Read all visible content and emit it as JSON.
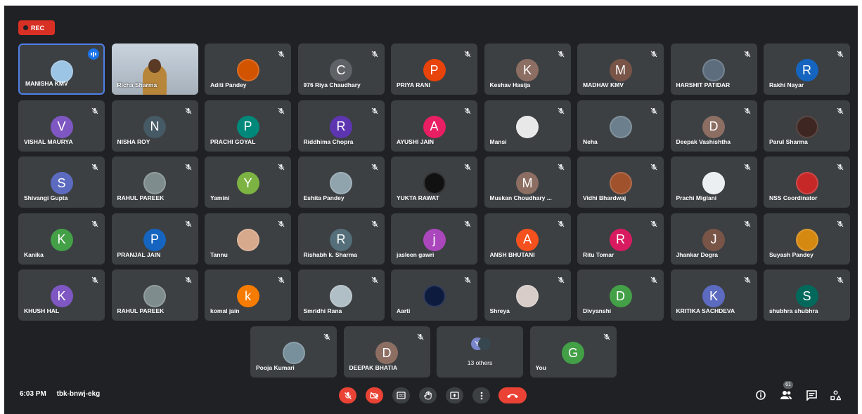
{
  "rec_label": "REC",
  "meeting": {
    "time": "6:03 PM",
    "code": "tbk-bnwj-ekg"
  },
  "participant_count_badge": "61",
  "tiles": [
    {
      "name": "MANISHA KMV",
      "type": "photo",
      "color": "#9cc4e4",
      "speaking": true
    },
    {
      "name": "Richa Sharma",
      "type": "video"
    },
    {
      "name": "Aditi Pandey",
      "type": "photo",
      "color": "#d35400"
    },
    {
      "name": "976 Riya Chaudhary",
      "initial": "C",
      "color": "#5f6368"
    },
    {
      "name": "PRIYA RANI",
      "initial": "P",
      "color": "#e8430a"
    },
    {
      "name": "Keshav Hasija",
      "initial": "K",
      "color": "#8d6e63"
    },
    {
      "name": "MADHAV KMV",
      "initial": "M",
      "color": "#795548"
    },
    {
      "name": "HARSHIT PATIDAR",
      "type": "photo",
      "color": "#5d6d7e"
    },
    {
      "name": "Rakhi Nayar",
      "initial": "R",
      "color": "#1565c0"
    },
    {
      "name": "VISHAL MAURYA",
      "initial": "V",
      "color": "#7e57c2"
    },
    {
      "name": "NISHA ROY",
      "initial": "N",
      "color": "#455a64"
    },
    {
      "name": "PRACHI GOYAL",
      "initial": "P",
      "color": "#00897b"
    },
    {
      "name": "Riddhima Chopra",
      "initial": "R",
      "color": "#5e35b1"
    },
    {
      "name": "AYUSHI JAIN",
      "initial": "A",
      "color": "#e91e63"
    },
    {
      "name": "Mansi",
      "type": "photo",
      "color": "#e8e8e8"
    },
    {
      "name": "Neha",
      "type": "photo",
      "color": "#6b7f8c"
    },
    {
      "name": "Deepak Vashishtha",
      "initial": "D",
      "color": "#8d6e63"
    },
    {
      "name": "Parul Sharma",
      "type": "photo",
      "color": "#3e2723"
    },
    {
      "name": "Shivangi Gupta",
      "initial": "S",
      "color": "#5c6bc0"
    },
    {
      "name": "RAHUL PAREEK",
      "type": "photo",
      "color": "#7f8c8d"
    },
    {
      "name": "Yamini",
      "initial": "Y",
      "color": "#7cb342"
    },
    {
      "name": "Eshita Pandey",
      "type": "photo",
      "color": "#90a4ae"
    },
    {
      "name": "YUKTA RAWAT",
      "type": "photo",
      "color": "#111111"
    },
    {
      "name": "Muskan Choudhary ...",
      "initial": "M",
      "color": "#8d6e63"
    },
    {
      "name": "Vidhi Bhardwaj",
      "type": "photo",
      "color": "#a0522d"
    },
    {
      "name": "Prachi Miglani",
      "type": "photo",
      "color": "#eceff1"
    },
    {
      "name": "NSS Coordinator",
      "type": "photo",
      "color": "#c62828"
    },
    {
      "name": "Kanika",
      "initial": "K",
      "color": "#43a047"
    },
    {
      "name": "PRANJAL JAIN",
      "initial": "P",
      "color": "#1565c0"
    },
    {
      "name": "Tannu",
      "type": "photo",
      "color": "#d7a98c"
    },
    {
      "name": "Rishabh k. Sharma",
      "initial": "R",
      "color": "#546e7a"
    },
    {
      "name": "jasleen gawri",
      "initial": "j",
      "color": "#ab47bc"
    },
    {
      "name": "ANSH BHUTANI",
      "initial": "A",
      "color": "#f4511e"
    },
    {
      "name": "Ritu Tomar",
      "initial": "R",
      "color": "#d81b60"
    },
    {
      "name": "Jhankar Dogra",
      "initial": "J",
      "color": "#795548"
    },
    {
      "name": "Suyash Pandey",
      "type": "photo",
      "color": "#d68910"
    },
    {
      "name": "KHUSH HAL",
      "initial": "K",
      "color": "#7e57c2"
    },
    {
      "name": "RAHUL PAREEK",
      "type": "photo",
      "color": "#7f8c8d"
    },
    {
      "name": "komal jain",
      "initial": "k",
      "color": "#f57c00"
    },
    {
      "name": "Smridhi Rana",
      "type": "photo",
      "color": "#b0bec5"
    },
    {
      "name": "Aarti",
      "type": "photo",
      "color": "#0d1b3e"
    },
    {
      "name": "Shreya",
      "type": "photo",
      "color": "#d7ccc8"
    },
    {
      "name": "Divyanshi",
      "initial": "D",
      "color": "#43a047"
    },
    {
      "name": "KRITIKA SACHDEVA",
      "initial": "K",
      "color": "#5c6bc0"
    },
    {
      "name": "shubhra shubhra",
      "initial": "S",
      "color": "#00695c"
    }
  ],
  "bottom_tiles": [
    {
      "name": "Pooja Kumari",
      "type": "photo",
      "color": "#78909c"
    },
    {
      "name": "DEEPAK BHATIA",
      "initial": "D",
      "color": "#8d6e63"
    },
    {
      "name": "13 others",
      "type": "others",
      "stack": [
        {
          "initial": "Y",
          "color": "#7986cb"
        },
        {
          "initial": "",
          "color": "#37474f"
        }
      ]
    },
    {
      "name": "You",
      "initial": "G",
      "color": "#43a047",
      "you": true
    }
  ],
  "controls": [
    {
      "id": "mic",
      "icon": "mic-off-icon",
      "style": "red"
    },
    {
      "id": "camera",
      "icon": "camera-off-icon",
      "style": "red"
    },
    {
      "id": "captions",
      "icon": "captions-icon",
      "style": "normal"
    },
    {
      "id": "raise-hand",
      "icon": "hand-icon",
      "style": "normal"
    },
    {
      "id": "present",
      "icon": "present-icon",
      "style": "normal"
    },
    {
      "id": "more",
      "icon": "more-icon",
      "style": "normal"
    },
    {
      "id": "end-call",
      "icon": "end-call-icon",
      "style": "end"
    }
  ],
  "right_icons": [
    "info-icon",
    "people-icon",
    "chat-icon",
    "activities-icon"
  ]
}
